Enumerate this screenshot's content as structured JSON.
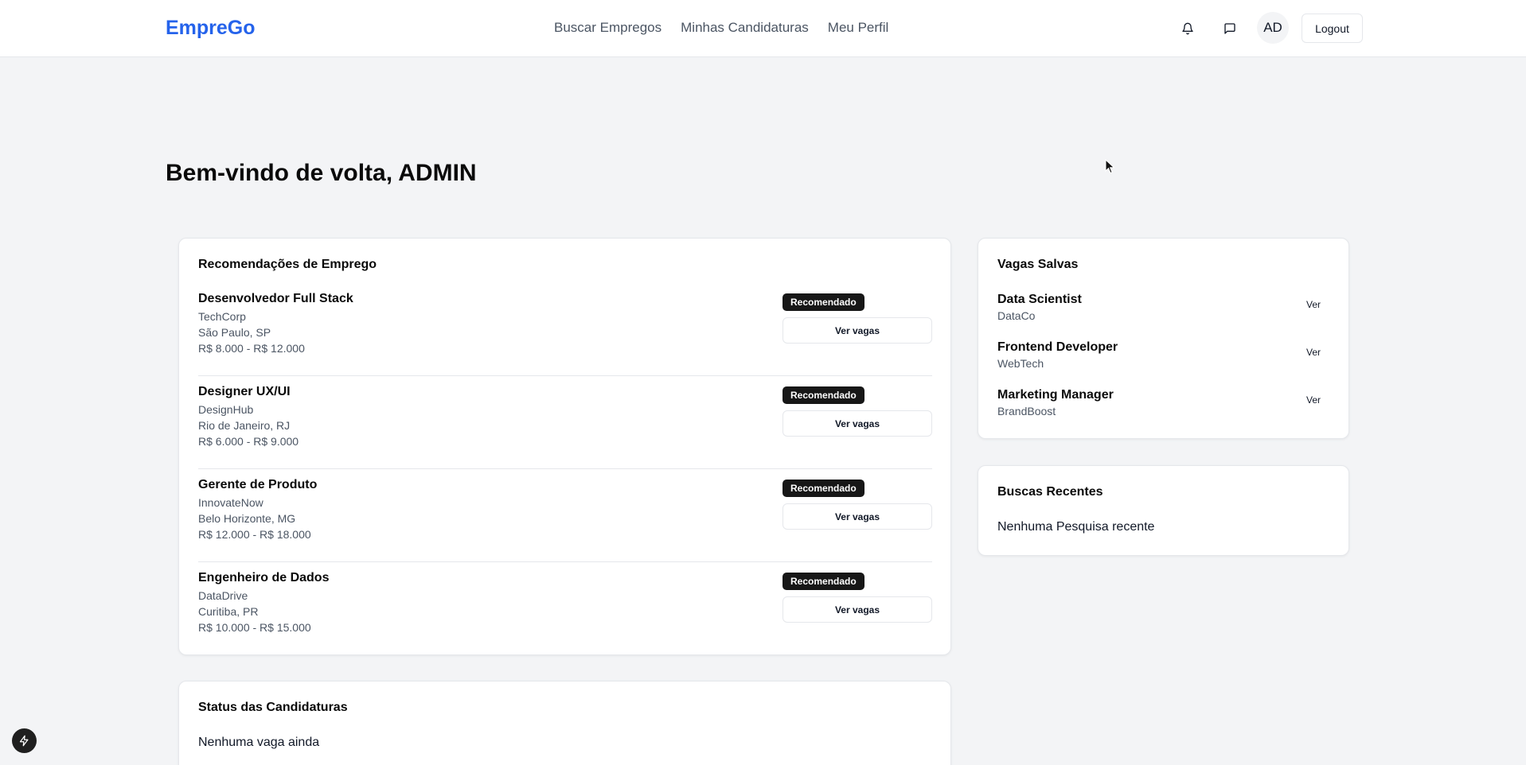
{
  "header": {
    "brand": "EmpreGo",
    "nav": [
      "Buscar Empregos",
      "Minhas Candidaturas",
      "Meu Perfil"
    ],
    "avatar_initials": "AD",
    "logout_label": "Logout",
    "icons": [
      "bell-icon",
      "message-icon"
    ]
  },
  "welcome": "Bem-vindo de volta, ADMIN",
  "recommendations": {
    "title": "Recomendações de Emprego",
    "badge": "Recomendado",
    "button_label": "Ver vagas",
    "jobs": [
      {
        "title": "Desenvolvedor Full Stack",
        "company": "TechCorp",
        "location": "São Paulo, SP",
        "salary": "R$ 8.000 - R$ 12.000"
      },
      {
        "title": "Designer UX/UI",
        "company": "DesignHub",
        "location": "Rio de Janeiro, RJ",
        "salary": "R$ 6.000 - R$ 9.000"
      },
      {
        "title": "Gerente de Produto",
        "company": "InnovateNow",
        "location": "Belo Horizonte, MG",
        "salary": "R$ 12.000 - R$ 18.000"
      },
      {
        "title": "Engenheiro de Dados",
        "company": "DataDrive",
        "location": "Curitiba, PR",
        "salary": "R$ 10.000 - R$ 15.000"
      }
    ]
  },
  "saved_jobs": {
    "title": "Vagas Salvas",
    "view_label": "Ver",
    "items": [
      {
        "title": "Data Scientist",
        "company": "DataCo"
      },
      {
        "title": "Frontend Developer",
        "company": "WebTech"
      },
      {
        "title": "Marketing Manager",
        "company": "BrandBoost"
      }
    ]
  },
  "recent_searches": {
    "title": "Buscas Recentes",
    "empty": "Nenhuma Pesquisa recente"
  },
  "application_status": {
    "title": "Status das Candidaturas",
    "empty": "Nenhuma vaga ainda"
  },
  "colors": {
    "brand": "#2563eb",
    "background": "#f3f4f6",
    "badge": "#171717"
  }
}
